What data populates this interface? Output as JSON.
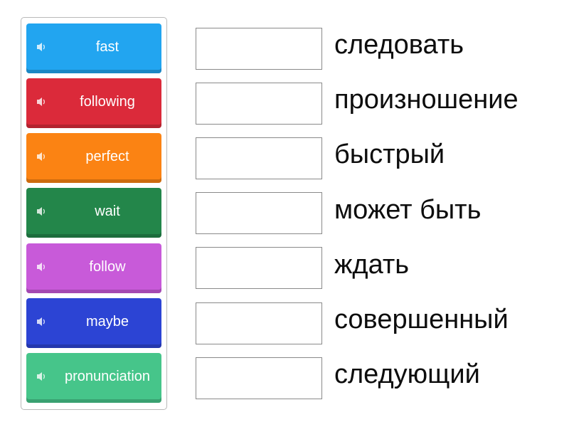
{
  "cards": [
    {
      "label": "fast",
      "color": "#22a5f0"
    },
    {
      "label": "following",
      "color": "#db2a3a"
    },
    {
      "label": "perfect",
      "color": "#fb8313"
    },
    {
      "label": "wait",
      "color": "#23864a"
    },
    {
      "label": "follow",
      "color": "#c85ad9"
    },
    {
      "label": "maybe",
      "color": "#2c44d4"
    },
    {
      "label": "pronunciation",
      "color": "#46c58a"
    }
  ],
  "targets": [
    {
      "label": "следовать"
    },
    {
      "label": "произношение"
    },
    {
      "label": "быстрый"
    },
    {
      "label": "может быть"
    },
    {
      "label": "ждать"
    },
    {
      "label": "совершенный"
    },
    {
      "label": "следующий"
    }
  ],
  "icons": {
    "card_audio": "speaker-icon"
  }
}
